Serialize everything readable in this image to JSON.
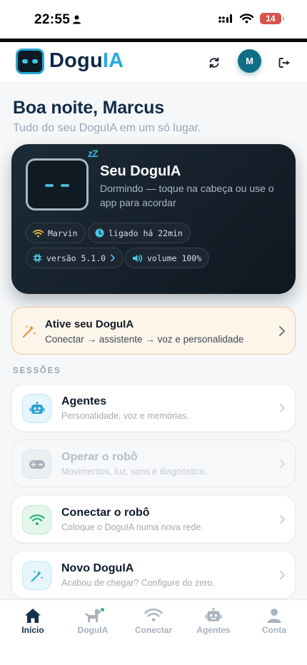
{
  "status_bar": {
    "time": "22:55",
    "battery": "14"
  },
  "header": {
    "brand_main": "Dogu",
    "brand_accent": "IA",
    "avatar_initial": "M"
  },
  "greeting": {
    "title": "Boa noite, Marcus",
    "subtitle": "Tudo do seu DoguIA em um só lugar."
  },
  "robot_card": {
    "sleep_indicator": "zZ",
    "title": "Seu DoguIA",
    "description": "Dormindo — toque na cabeça ou use o app para acordar",
    "chips": {
      "wifi": "Marvin",
      "uptime": "ligado há 22min",
      "version": "versão 5.1.0",
      "volume": "volume 100%"
    }
  },
  "setup_card": {
    "title": "Ative seu DoguIA",
    "subtitle": "Conectar → assistente → voz e personalidade"
  },
  "sections_label": "SESSÕES",
  "sessions": [
    {
      "title": "Agentes",
      "subtitle": "Personalidade, voz e memórias.",
      "icon": "robot-icon",
      "enabled": true
    },
    {
      "title": "Operar o robô",
      "subtitle": "Movimentos, luz, sons e diagnóstico.",
      "icon": "gamepad-icon",
      "enabled": false
    },
    {
      "title": "Conectar o robô",
      "subtitle": "Coloque o DoguIA numa nova rede.",
      "icon": "wifi-icon",
      "enabled": true
    },
    {
      "title": "Novo DoguIA",
      "subtitle": "Acabou de chegar? Configure do zero.",
      "icon": "magic-wand-icon",
      "enabled": true
    }
  ],
  "tabs": [
    {
      "label": "Início",
      "icon": "home-icon",
      "active": true
    },
    {
      "label": "DoguIA",
      "icon": "dog-icon",
      "active": false
    },
    {
      "label": "Conectar",
      "icon": "wifi-icon",
      "active": false
    },
    {
      "label": "Agentes",
      "icon": "robot-icon",
      "active": false
    },
    {
      "label": "Conta",
      "icon": "user-icon",
      "active": false
    }
  ],
  "colors": {
    "brand_navy": "#0f2a44",
    "brand_cyan": "#28a9de",
    "avatar_teal": "#0f6f86",
    "setup_bg": "#fdf5ea",
    "setup_border": "#f4c79a",
    "battery_low": "#d9534f"
  }
}
